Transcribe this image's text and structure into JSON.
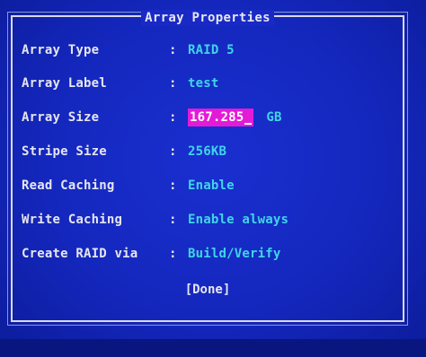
{
  "dialog": {
    "title": "Array Properties",
    "fields": [
      {
        "label": "Array Type",
        "value": "RAID 5"
      },
      {
        "label": "Array Label",
        "value": "test"
      },
      {
        "label": "Array Size",
        "value": "167.285",
        "unit": "GB"
      },
      {
        "label": "Stripe Size",
        "value": "256KB"
      },
      {
        "label": "Read Caching",
        "value": "Enable"
      },
      {
        "label": "Write Caching",
        "value": "Enable always"
      },
      {
        "label": "Create RAID via",
        "value": "Build/Verify"
      }
    ],
    "separator": ":",
    "done_label": "[Done]"
  },
  "colors": {
    "background": "#1427bd",
    "label_text": "#e6e6ef",
    "value_text": "#3fd6e8",
    "edit_highlight": "#e41bd6"
  }
}
